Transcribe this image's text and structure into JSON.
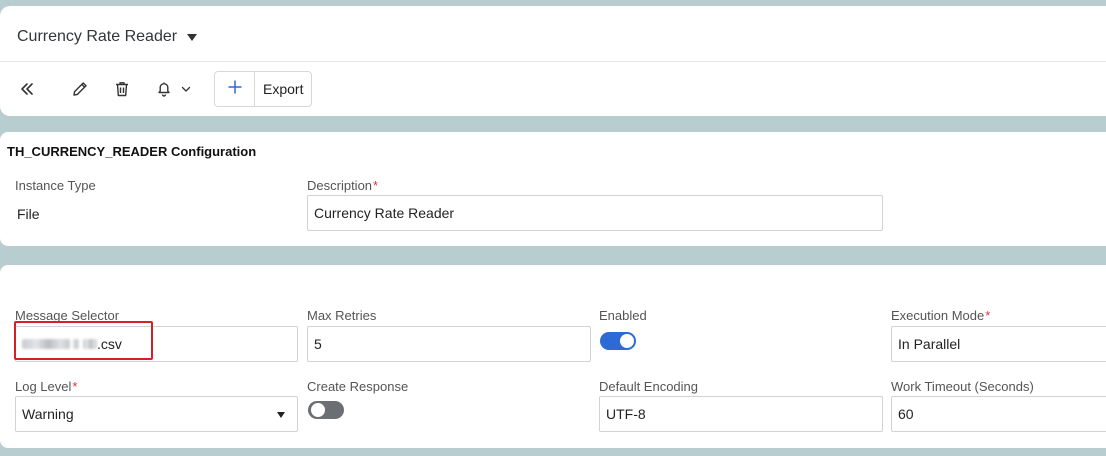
{
  "header": {
    "title": "Currency Rate Reader",
    "toolbar": {
      "collapse_icon": "double-chevron-left-icon",
      "edit_icon": "pencil-icon",
      "delete_icon": "trash-icon",
      "notification_icon": "bell-icon",
      "add_icon": "plus-icon",
      "export_label": "Export"
    }
  },
  "config_card": {
    "title": "TH_CURRENCY_READER Configuration",
    "instance_type_label": "Instance Type",
    "instance_type_value": "File",
    "description_label": "Description",
    "description_value": "Currency Rate Reader"
  },
  "settings_card": {
    "message_selector_label": "Message Selector",
    "message_selector_visible_suffix": ".csv",
    "max_retries_label": "Max Retries",
    "max_retries_value": "5",
    "enabled_label": "Enabled",
    "enabled": true,
    "execution_mode_label": "Execution Mode",
    "execution_mode_value": "In Parallel",
    "log_level_label": "Log Level",
    "log_level_value": "Warning",
    "create_response_label": "Create Response",
    "create_response": false,
    "default_encoding_label": "Default Encoding",
    "default_encoding_value": "UTF-8",
    "work_timeout_label": "Work Timeout (Seconds)",
    "work_timeout_value": "60"
  },
  "colors": {
    "accent": "#2d6ad6",
    "required": "#d9333f",
    "highlight_box": "#d52028",
    "background": "#b7cdd0"
  }
}
